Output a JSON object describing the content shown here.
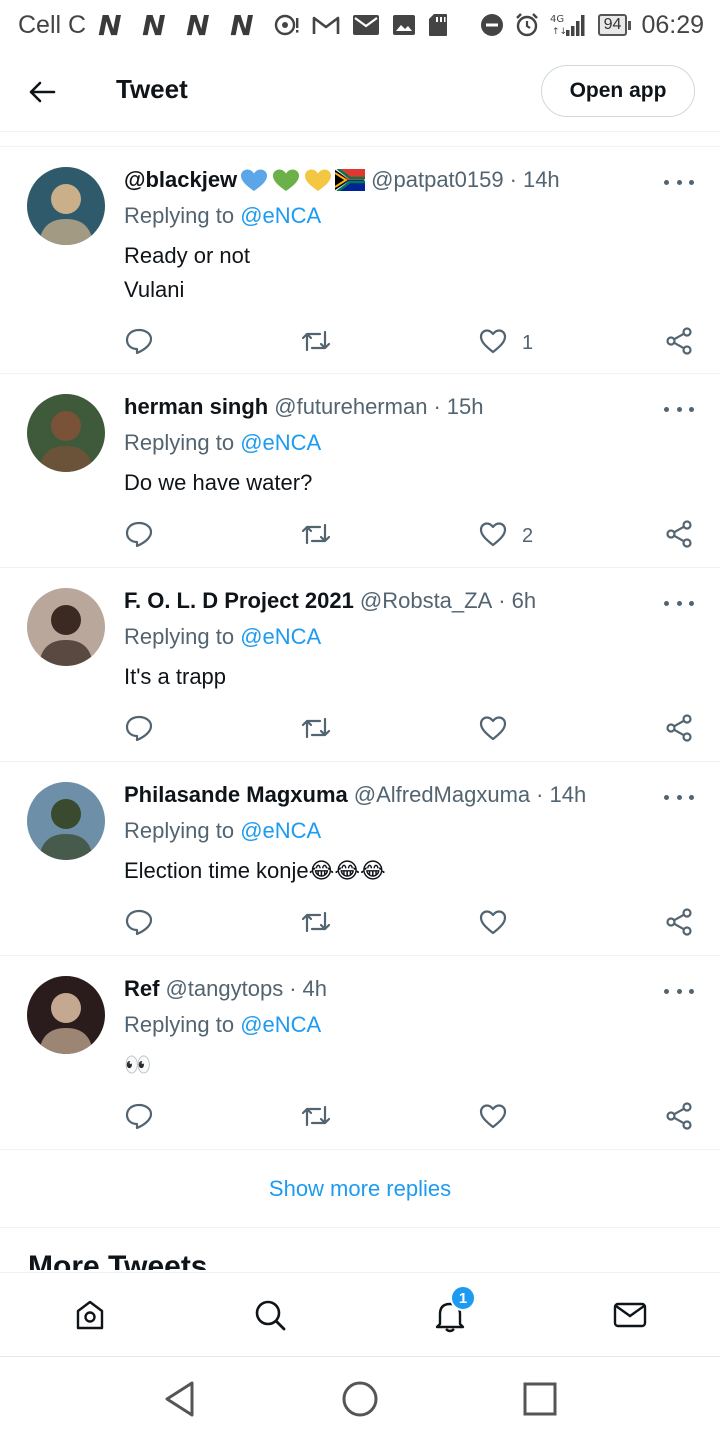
{
  "status_bar": {
    "carrier": "Cell C",
    "battery": "94",
    "time": "06:29",
    "network": "4G"
  },
  "header": {
    "title": "Tweet",
    "open_app_label": "Open app"
  },
  "tweets": [
    {
      "name": "@blackjew",
      "handle": "@patpat0159",
      "time": "14h",
      "reply_prefix": "Replying to",
      "reply_to": "@eNCA",
      "text": "Ready or not\nVulani",
      "likes": "1",
      "avatar_colors": [
        "#2e5a6b",
        "#c9b08a"
      ]
    },
    {
      "name": "herman singh",
      "handle": "@futureherman",
      "time": "15h",
      "reply_prefix": "Replying to",
      "reply_to": "@eNCA",
      "text": "Do we have water?",
      "likes": "2",
      "avatar_colors": [
        "#3f5a3a",
        "#7a5238"
      ]
    },
    {
      "name": "F. O. L. D Project 2021",
      "handle": "@Robsta_ZA",
      "time": "6h",
      "reply_prefix": "Replying to",
      "reply_to": "@eNCA",
      "text": "It's a trapp",
      "likes": "",
      "avatar_colors": [
        "#b8a79a",
        "#3b2a22"
      ]
    },
    {
      "name": "Philasande Magxuma",
      "handle": "@AlfredMagxuma",
      "time": "14h",
      "reply_prefix": "Replying to",
      "reply_to": "@eNCA",
      "text": "Election time konje😂😂😂",
      "likes": "",
      "avatar_colors": [
        "#6d8fa8",
        "#3a4a2e"
      ]
    },
    {
      "name": "Ref",
      "handle": "@tangytops",
      "time": "4h",
      "reply_prefix": "Replying to",
      "reply_to": "@eNCA",
      "text": "👀",
      "likes": "",
      "avatar_colors": [
        "#2a1c1c",
        "#c4a890"
      ]
    }
  ],
  "show_more_label": "Show more replies",
  "more_tweets_label": "More Tweets",
  "nav": {
    "notifications_badge": "1"
  },
  "colors": {
    "accent": "#1d9bf0",
    "text": "#0f1419",
    "muted": "#536471",
    "divider": "#eff3f4"
  }
}
